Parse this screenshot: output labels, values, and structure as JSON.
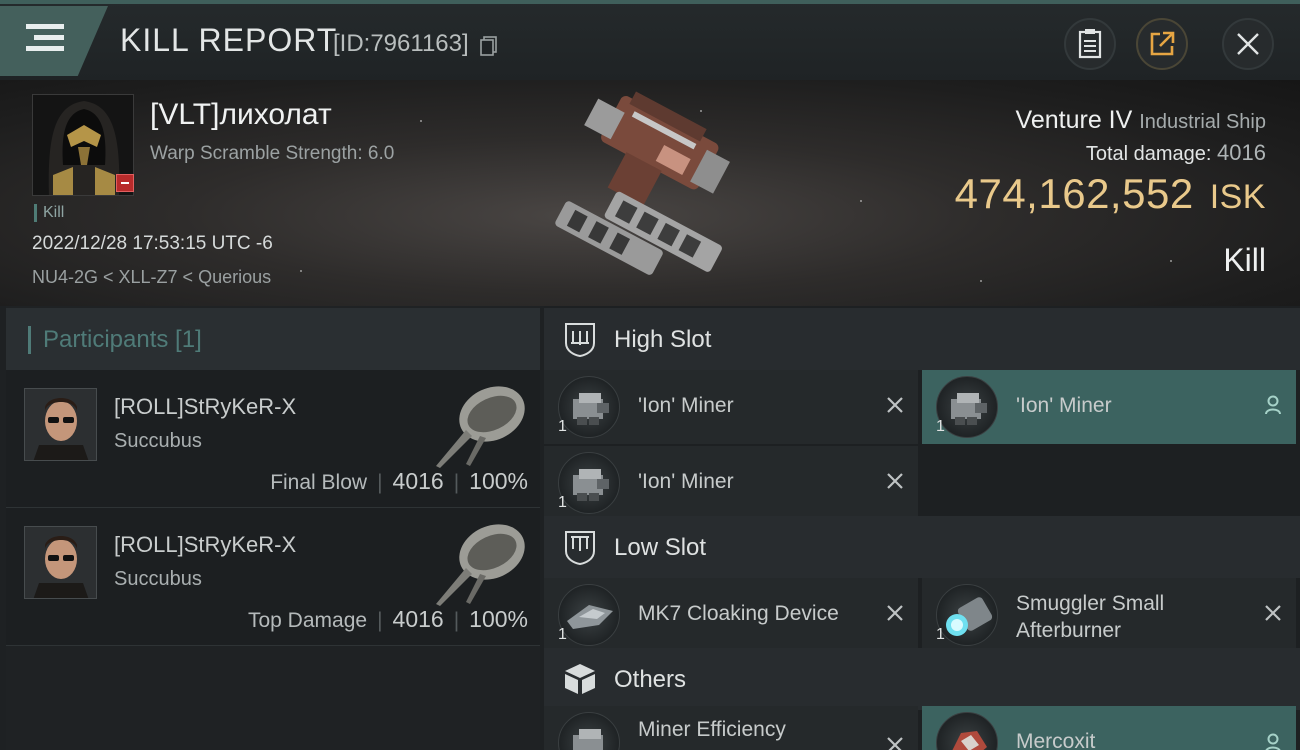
{
  "header": {
    "title": "KILL REPORT",
    "report_id": "[ID:7961163]",
    "icons": [
      "menu-icon",
      "copy-icon",
      "clipboard-icon",
      "share-icon",
      "close-icon"
    ]
  },
  "victim": {
    "name": "[VLT]лихолат",
    "scramble": "Warp Scramble Strength: 6.0",
    "tag": "Kill",
    "datetime": "2022/12/28 17:53:15 UTC -6",
    "location": "NU4-2G < XLL-Z7 < Querious",
    "ship_name": "Venture IV",
    "ship_class": "Industrial Ship",
    "total_damage_label": "Total damage:",
    "total_damage": "4016",
    "isk_value": "474,162,552",
    "isk_unit": "ISK",
    "result": "Kill"
  },
  "participants": {
    "label": "Participants [1]",
    "rows": [
      {
        "name": "[ROLL]StRyKeR-X",
        "ship": "Succubus",
        "role": "Final Blow",
        "damage": "4016",
        "percent": "100%"
      },
      {
        "name": "[ROLL]StRyKeR-X",
        "ship": "Succubus",
        "role": "Top Damage",
        "damage": "4016",
        "percent": "100%"
      }
    ]
  },
  "fitting": {
    "high_slot": {
      "label": "High Slot",
      "items": [
        {
          "name": "'Ion' Miner",
          "qty": "1",
          "status": "destroyed"
        },
        {
          "name": "'Ion' Miner",
          "qty": "1",
          "status": "dropped"
        },
        {
          "name": "'Ion' Miner",
          "qty": "1",
          "status": "destroyed"
        }
      ]
    },
    "low_slot": {
      "label": "Low Slot",
      "items": [
        {
          "name": "MK7 Cloaking Device",
          "qty": "1",
          "status": "destroyed"
        },
        {
          "name_line1": "Smuggler Small",
          "name_line2": "Afterburner",
          "qty": "1",
          "status": "destroyed"
        }
      ]
    },
    "others": {
      "label": "Others",
      "items": [
        {
          "name": "Miner Efficiency",
          "status": "destroyed"
        },
        {
          "name": "Mercoxit",
          "status": "dropped"
        }
      ]
    }
  },
  "colors": {
    "accent_teal": "#4f7b78",
    "selected_row": "#3c6360",
    "isk_gold": "#e9c98b",
    "kill_red": "#b82b2b"
  }
}
